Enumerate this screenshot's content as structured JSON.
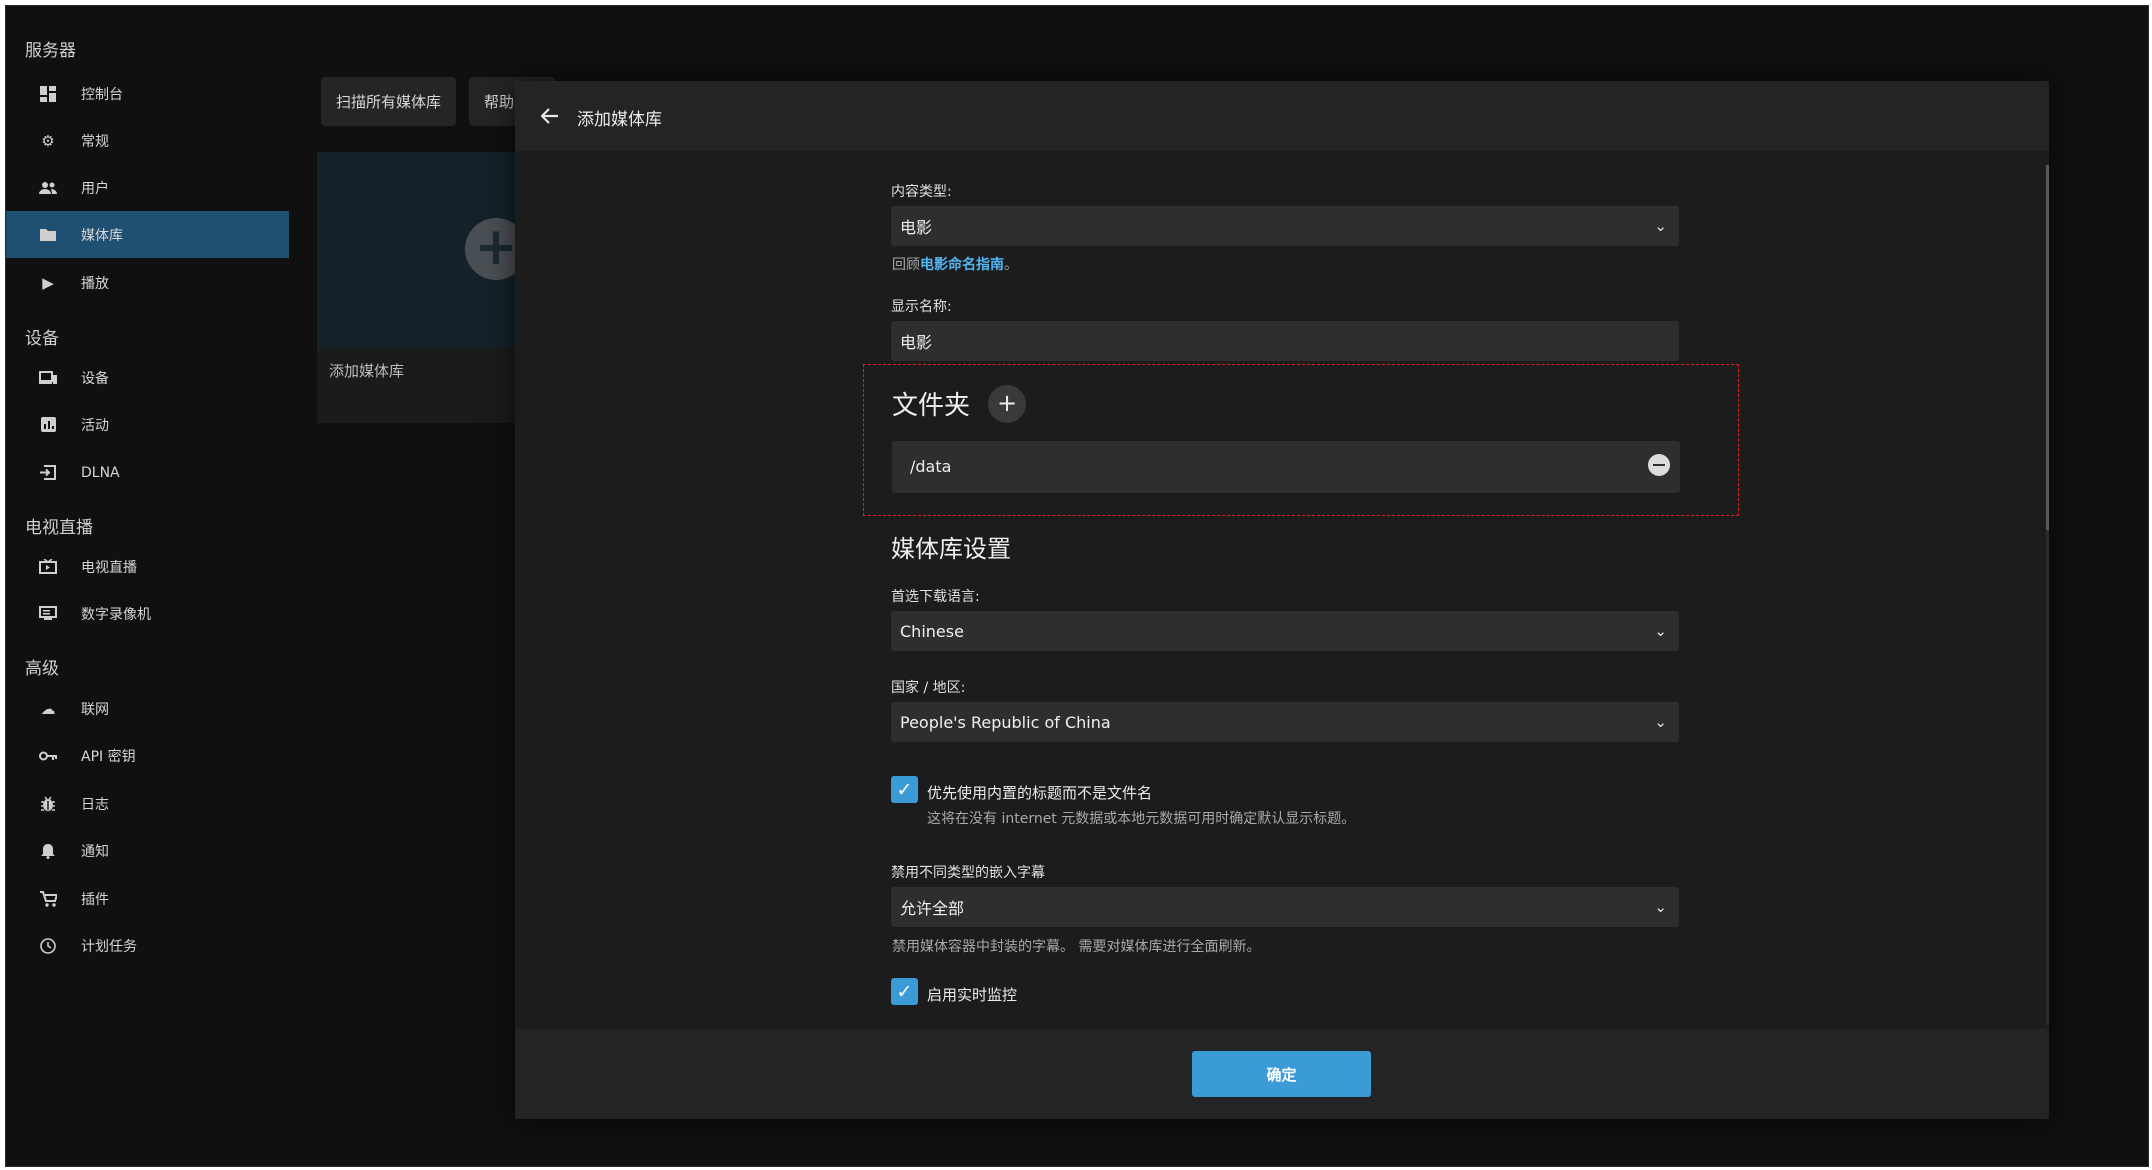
{
  "sidebar": {
    "sections": [
      {
        "title": "服务器",
        "items": [
          {
            "label": "控制台",
            "icon": "dashboard-icon"
          },
          {
            "label": "常规",
            "icon": "gear-icon"
          },
          {
            "label": "用户",
            "icon": "users-icon"
          },
          {
            "label": "媒体库",
            "icon": "folder-icon",
            "active": true
          },
          {
            "label": "播放",
            "icon": "play-icon"
          }
        ]
      },
      {
        "title": "设备",
        "items": [
          {
            "label": "设备",
            "icon": "devices-icon"
          },
          {
            "label": "活动",
            "icon": "activity-icon"
          },
          {
            "label": "DLNA",
            "icon": "input-icon"
          }
        ]
      },
      {
        "title": "电视直播",
        "items": [
          {
            "label": "电视直播",
            "icon": "live-tv-icon"
          },
          {
            "label": "数字录像机",
            "icon": "dvr-icon"
          }
        ]
      },
      {
        "title": "高级",
        "items": [
          {
            "label": "联网",
            "icon": "cloud-icon"
          },
          {
            "label": "API 密钥",
            "icon": "key-icon"
          },
          {
            "label": "日志",
            "icon": "bug-icon"
          },
          {
            "label": "通知",
            "icon": "bell-icon"
          },
          {
            "label": "插件",
            "icon": "cart-icon"
          },
          {
            "label": "计划任务",
            "icon": "clock-icon"
          }
        ]
      }
    ]
  },
  "page": {
    "scan_all_label": "扫描所有媒体库",
    "help_label": "帮助",
    "add_library_card_label": "添加媒体库"
  },
  "dialog": {
    "title": "添加媒体库",
    "content_type_label": "内容类型:",
    "content_type_value": "电影",
    "naming_hint_prefix": "回顾",
    "naming_hint_link": "电影命名指南",
    "naming_hint_suffix": "。",
    "display_name_label": "显示名称:",
    "display_name_value": "电影",
    "folders_heading": "文件夹",
    "folder_path": "/data",
    "library_settings_heading": "媒体库设置",
    "language_label": "首选下载语言:",
    "language_value": "Chinese",
    "country_label": "国家 / 地区:",
    "country_value": "People's Republic of China",
    "embedded_titles_label": "优先使用内置的标题而不是文件名",
    "embedded_titles_hint": "这将在没有 internet 元数据或本地元数据可用时确定默认显示标题。",
    "embedded_titles_checked": true,
    "disable_subs_label": "禁用不同类型的嵌入字幕",
    "disable_subs_value": "允许全部",
    "disable_subs_hint": "禁用媒体容器中封装的字幕。 需要对媒体库进行全面刷新。",
    "realtime_monitor_label": "启用实时监控",
    "realtime_monitor_checked": true,
    "ok_label": "确定"
  }
}
